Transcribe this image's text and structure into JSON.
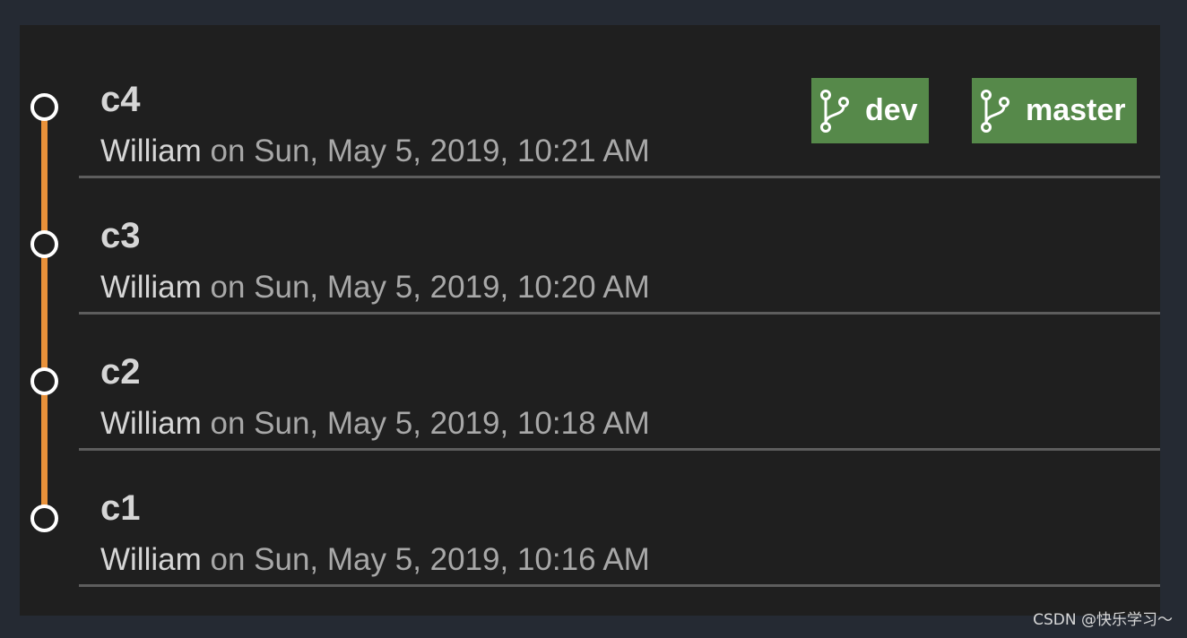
{
  "commits": [
    {
      "title": "c4",
      "author": "William",
      "date": "on Sun, May 5, 2019, 10:21 AM"
    },
    {
      "title": "c3",
      "author": "William",
      "date": "on Sun, May 5, 2019, 10:20 AM"
    },
    {
      "title": "c2",
      "author": "William",
      "date": "on Sun, May 5, 2019, 10:18 AM"
    },
    {
      "title": "c1",
      "author": "William",
      "date": "on Sun, May 5, 2019, 10:16 AM"
    }
  ],
  "branches": [
    {
      "label": "dev",
      "icon": "git-branch-icon"
    },
    {
      "label": "master",
      "icon": "git-branch-icon"
    }
  ],
  "colors": {
    "graph_line": "#e8913a",
    "branch_tag": "#56894a",
    "background": "#1f1f1f"
  },
  "watermark": "CSDN @快乐学习～"
}
